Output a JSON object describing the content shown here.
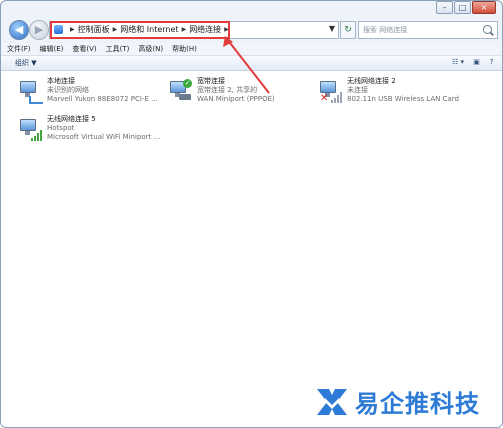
{
  "window": {
    "controls": [
      "–",
      "□",
      "×"
    ]
  },
  "navigation": {
    "back_glyph": "◀",
    "forward_glyph": "▶",
    "breadcrumbs": [
      "控制面板",
      "网络和 Internet",
      "网络连接"
    ],
    "separator": "▶",
    "dropdown_glyph": "▼",
    "refresh_glyph": "↻",
    "search_placeholder": "搜索 网络连接"
  },
  "menu": {
    "items": [
      "文件(F)",
      "编辑(E)",
      "查看(V)",
      "工具(T)",
      "高级(N)",
      "帮助(H)"
    ]
  },
  "toolbar": {
    "organize_label": "组织 ▼",
    "view_glyph": "☷ ▾",
    "preview_glyph": "▣",
    "help_glyph": "?"
  },
  "connections": [
    {
      "name": "本地连接",
      "status": "未识别的网络",
      "device": "Marvell Yukon 88E8072 PCI-E ...",
      "icon": "wired-network-icon"
    },
    {
      "name": "宽带连接",
      "status": "宽带连接 2, 共享的",
      "device": "WAN Miniport (PPPOE)",
      "icon": "broadband-network-icon"
    },
    {
      "name": "无线网络连接 2",
      "status": "未连接",
      "device": "802.11n USB Wireless LAN Card",
      "icon": "wireless-disconnected-icon"
    },
    {
      "name": "无线网络连接 5",
      "status": "Hotspot",
      "device": "Microsoft Virtual WiFi Miniport ...",
      "icon": "wireless-network-icon"
    }
  ],
  "watermark": {
    "text": "易企推科技"
  },
  "colors": {
    "highlight": "#e23b3b",
    "brand": "#2d7bd6"
  }
}
